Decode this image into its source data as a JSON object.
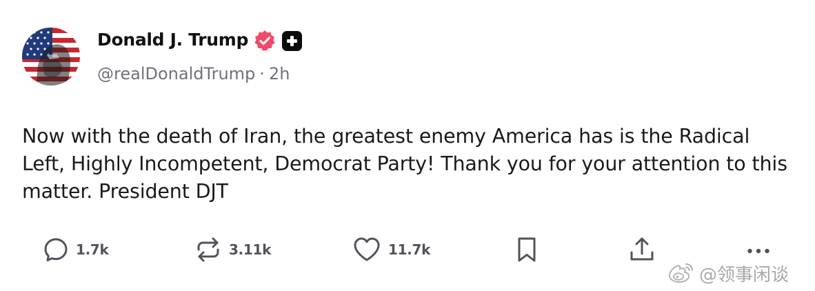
{
  "author": {
    "display_name": "Donald J. Trump",
    "handle": "@realDonaldTrump",
    "separator": "·",
    "time_ago": "2h",
    "avatar_icon": "avatar-flag-portrait",
    "verified_icon": "verified-badge-icon",
    "verified_color": "#ef4a6b",
    "plus_icon": "plus-badge-icon"
  },
  "post": {
    "text": "Now with the death of Iran, the greatest enemy America has is the Radical Left, Highly Incompetent, Democrat Party! Thank you for your attention to this matter. President DJT"
  },
  "actions": {
    "reply": {
      "icon": "reply-icon",
      "count": "1.7k"
    },
    "retruth": {
      "icon": "retruth-icon",
      "count": "3.11k"
    },
    "like": {
      "icon": "heart-icon",
      "count": "11.7k"
    },
    "bookmark": {
      "icon": "bookmark-icon"
    },
    "share": {
      "icon": "share-icon"
    },
    "more": {
      "icon": "more-icon"
    }
  },
  "watermark": {
    "icon": "weibo-icon",
    "text": "@领事闲谈"
  },
  "colors": {
    "text": "#1a1a1a",
    "muted": "#71717a",
    "icon": "#52525b",
    "badge": "#ef4a6b"
  }
}
